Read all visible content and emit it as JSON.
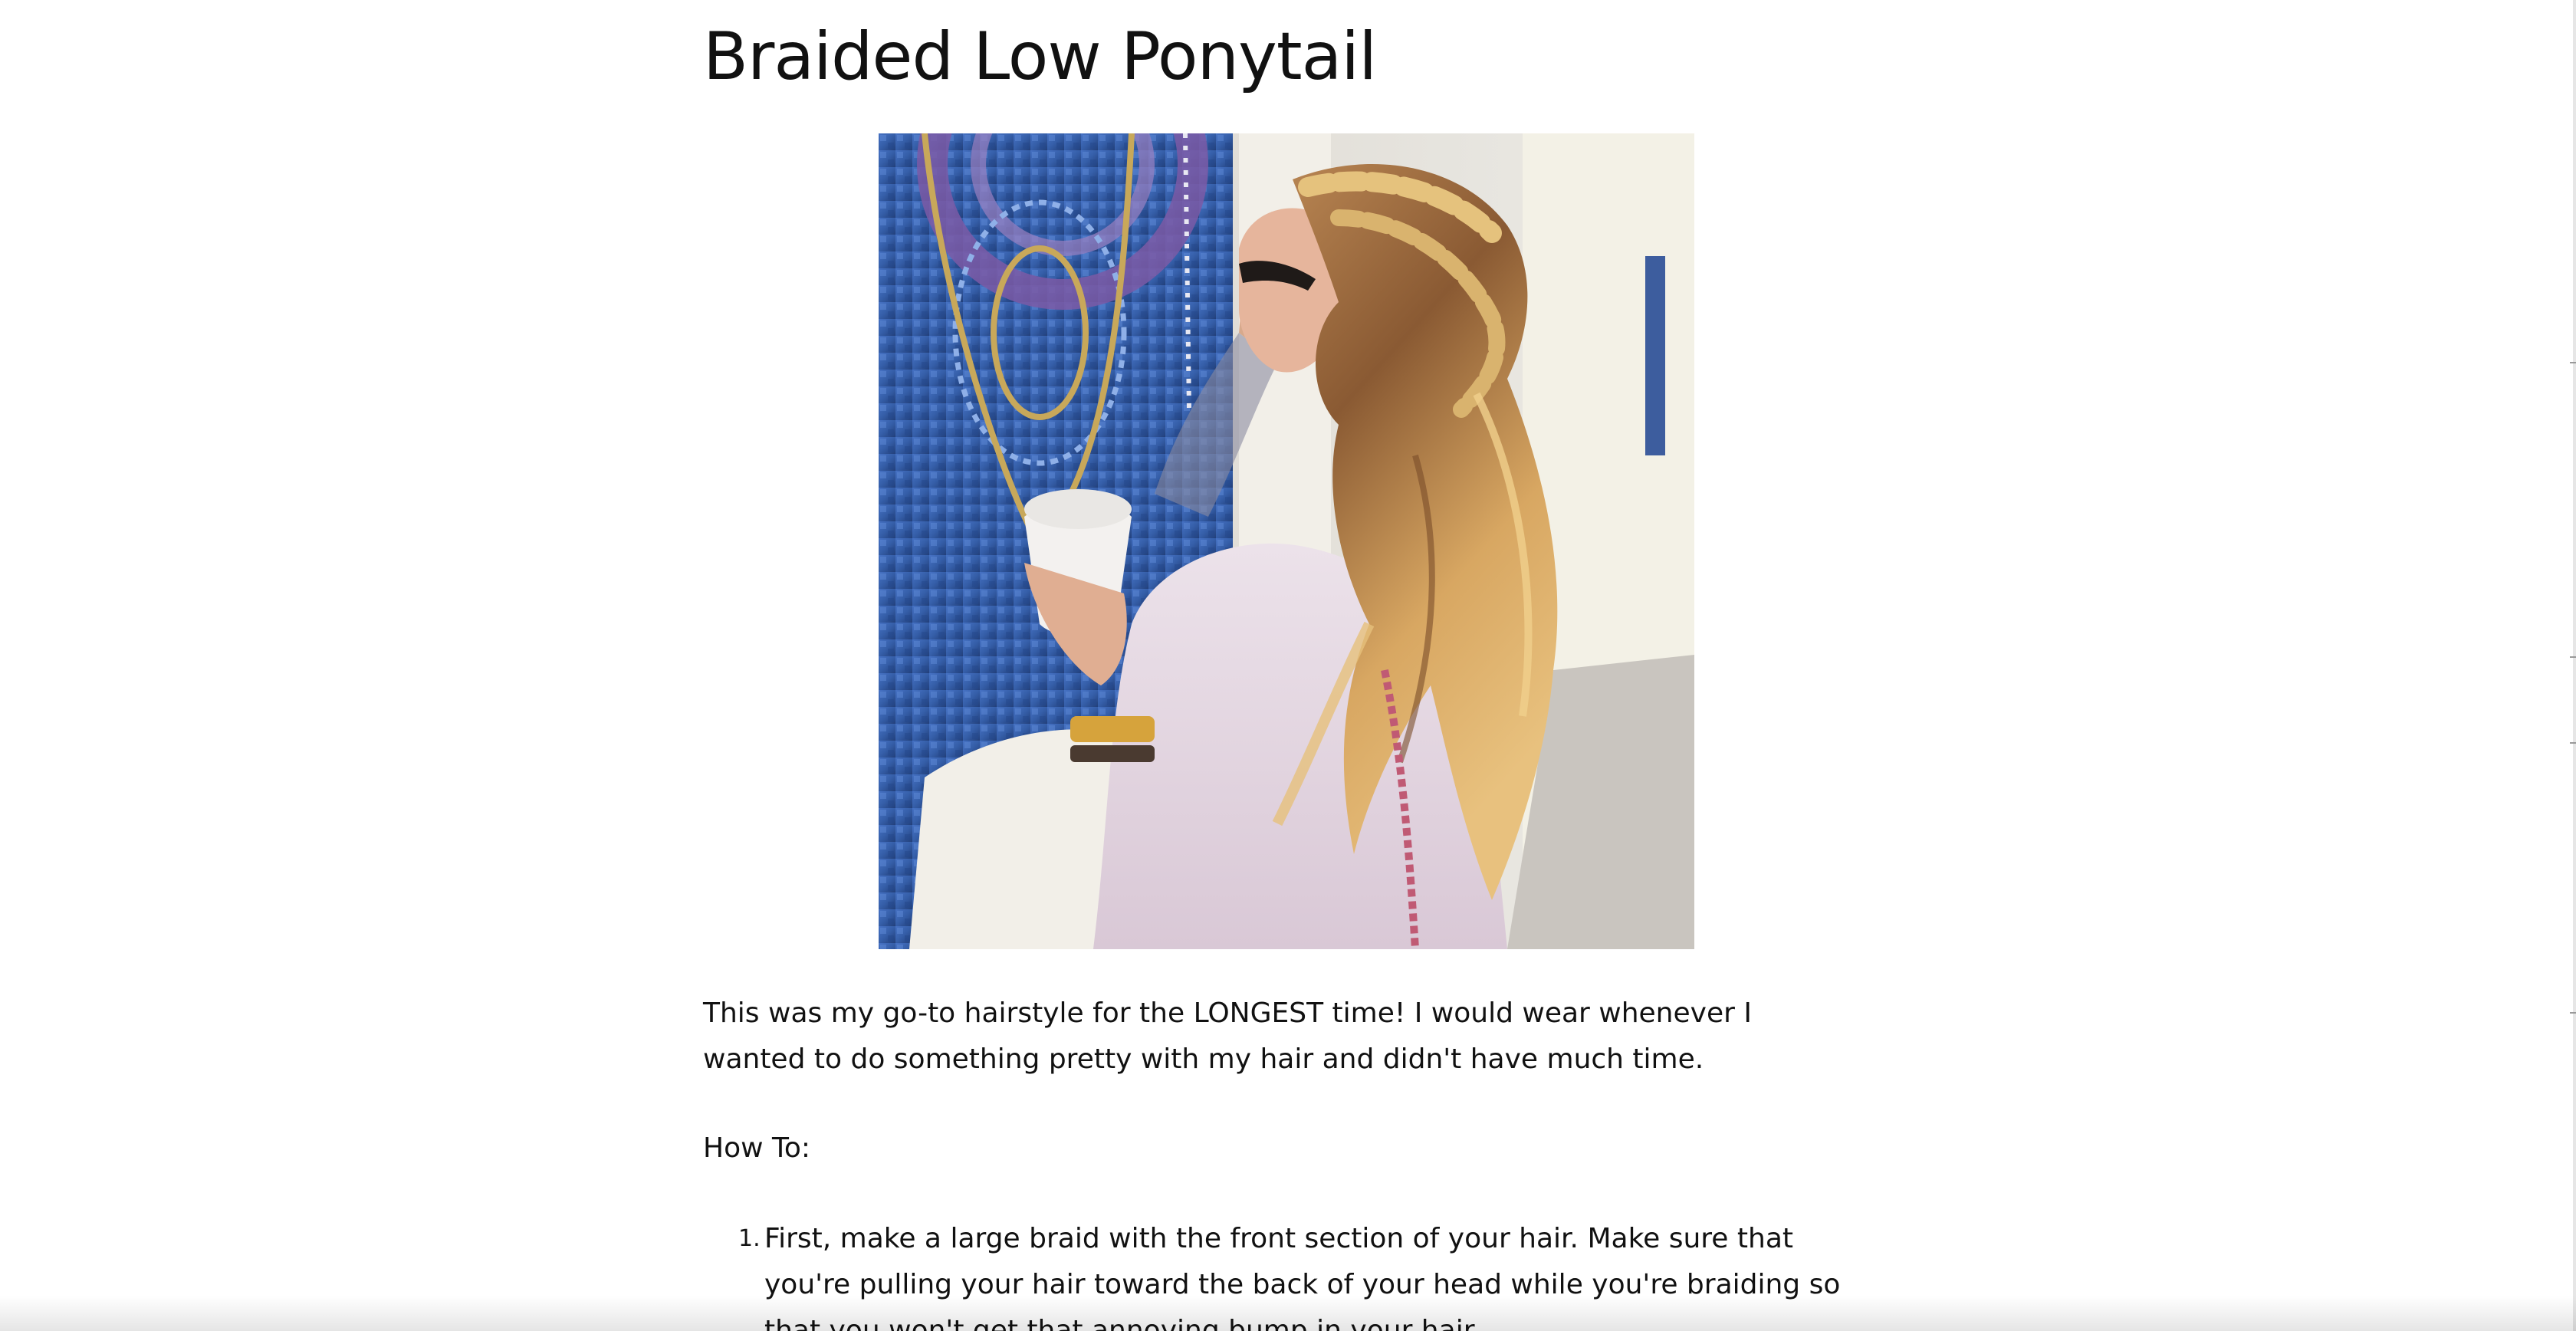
{
  "article": {
    "title": "Braided Low Ponytail",
    "photo_alt": "Braided Low Ponytail",
    "paragraph": "This was my go-to hairstyle for the LONGEST time! I would wear whenever I wanted to do something pretty with my hair and didn't have much time.",
    "howto_label": "How To:",
    "steps": [
      {
        "number": "1.",
        "text": "First, make a large braid with the front section of your hair. Make sure that you're pulling your hair toward the back of your head while you're braiding so that you won't get that annoying bump in your hair."
      }
    ]
  },
  "colors": {
    "text": "#111111",
    "background": "#ffffff",
    "mosaic_blue": "#3b63b0",
    "mosaic_purple": "#6e57a0",
    "hair_blonde": "#c99759"
  }
}
